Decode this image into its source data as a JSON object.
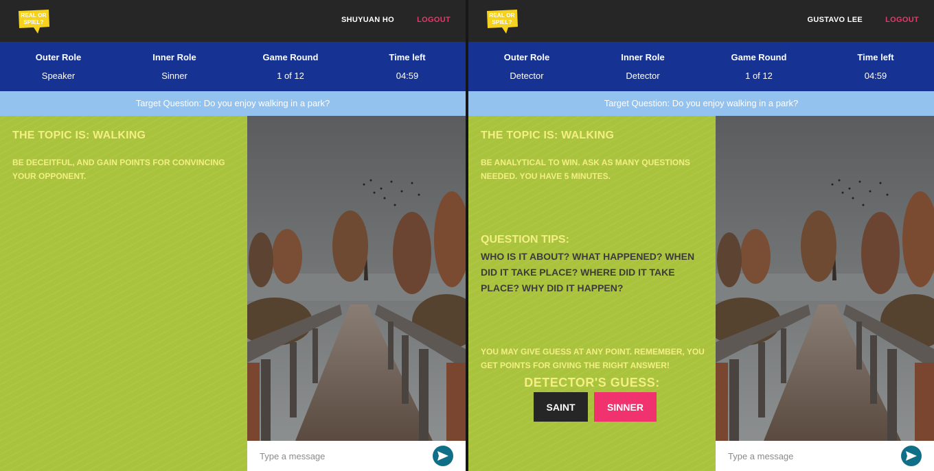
{
  "logo": {
    "line1": "REAL OR",
    "line2": "SPIEL?",
    "color": "#f5d21e"
  },
  "panels": [
    {
      "username": "SHUYUAN HO",
      "logout_label": "LOGOUT",
      "info": [
        {
          "heading": "Outer Role",
          "value": "Speaker"
        },
        {
          "heading": "Inner Role",
          "value": "Sinner"
        },
        {
          "heading": "Game Round",
          "value": "1 of 12"
        },
        {
          "heading": "Time left",
          "value": "04:59"
        }
      ],
      "target_question": "Target Question: Do you enjoy walking in a park?",
      "topic": "THE TOPIC IS: WALKING",
      "instructions": "BE DECEITFUL, AND GAIN POINTS FOR CONVINCING YOUR OPPONENT.",
      "chat_placeholder": "Type a message"
    },
    {
      "username": "GUSTAVO LEE",
      "logout_label": "LOGOUT",
      "info": [
        {
          "heading": "Outer Role",
          "value": "Detector"
        },
        {
          "heading": "Inner Role",
          "value": "Detector"
        },
        {
          "heading": "Game Round",
          "value": "1 of 12"
        },
        {
          "heading": "Time left",
          "value": "04:59"
        }
      ],
      "target_question": "Target Question: Do you enjoy walking in a park?",
      "topic": "THE TOPIC IS: WALKING",
      "instructions": "BE ANALYTICAL TO WIN. ASK AS MANY QUESTIONS NEEDED. YOU HAVE 5 MINUTES.",
      "tips_heading": "QUESTION TIPS:",
      "tips": "WHO IS IT ABOUT? WHAT HAPPENED? WHEN DID IT TAKE PLACE? WHERE DID IT TAKE PLACE? WHY DID IT HAPPEN?",
      "reminder": "YOU MAY GIVE GUESS AT ANY POINT. REMEMBER, YOU GET POINTS FOR GIVING THE RIGHT ANSWER!",
      "guess_heading": "DETECTOR'S GUESS:",
      "saint_label": "SAINT",
      "sinner_label": "SINNER",
      "chat_placeholder": "Type a message"
    }
  ],
  "colors": {
    "topbar": "#262626",
    "infobar": "#163393",
    "question_bar": "#94c2ee",
    "panel_green": "#a9c33c",
    "accent_yellow": "#f4ef84",
    "logout": "#e8386b",
    "sinner_button": "#f0326f",
    "saint_button": "#262626",
    "send_button": "#0f6f86"
  },
  "icons": {
    "send": "send-arrow-icon",
    "photo": "park-path-photo"
  }
}
